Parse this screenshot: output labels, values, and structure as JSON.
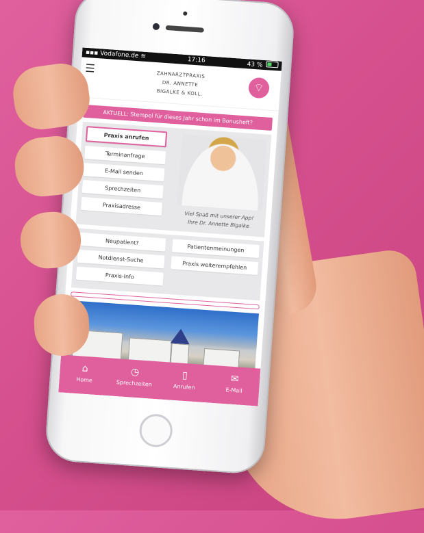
{
  "status_bar": {
    "carrier": "Vodafone.de",
    "time": "17:16",
    "battery": "43 %"
  },
  "header": {
    "line1": "ZAHNARZTPRAXIS",
    "line2": "DR. ANNETTE",
    "line3": "BIGALKE & KOLL."
  },
  "banner": "AKTUELL: Stempel für dieses Jahr schon im Bonusheft?",
  "primary_buttons": [
    {
      "label": "Praxis anrufen"
    },
    {
      "label": "Terminanfrage"
    },
    {
      "label": "E-Mail senden"
    },
    {
      "label": "Sprechzeiten"
    },
    {
      "label": "Praxisadresse"
    }
  ],
  "quote": {
    "line1": "Viel Spaß mit unserer App!",
    "line2": "Ihre Dr. Annette Bigalke"
  },
  "secondary_left": [
    {
      "label": "Neupatient?"
    },
    {
      "label": "Notdienst-Suche"
    },
    {
      "label": "Praxis-Info"
    }
  ],
  "secondary_right": [
    {
      "label": "Patientenmeinungen"
    },
    {
      "label": "Praxis weiterempfehlen"
    }
  ],
  "bottom_nav": [
    {
      "label": "Home",
      "icon": "home-icon"
    },
    {
      "label": "Sprechzeiten",
      "icon": "clock-icon"
    },
    {
      "label": "Anrufen",
      "icon": "phone-icon"
    },
    {
      "label": "E-Mail",
      "icon": "mail-icon"
    }
  ],
  "colors": {
    "accent": "#e0609e",
    "background": "#d6508f"
  }
}
